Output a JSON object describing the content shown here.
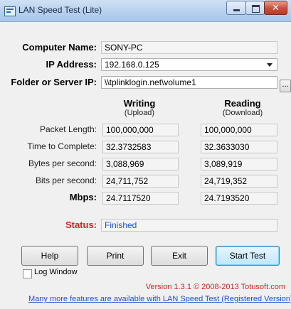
{
  "window": {
    "title": "LAN Speed Test (Lite)"
  },
  "form": {
    "computer_name_label": "Computer Name:",
    "computer_name_value": "SONY-PC",
    "ip_address_label": "IP Address:",
    "ip_address_value": "192.168.0.125",
    "folder_label": "Folder or Server IP:",
    "folder_value": "\\\\tplinklogin.net\\volume1",
    "browse_label": "..."
  },
  "columns": {
    "writing": {
      "title": "Writing",
      "sub": "(Upload)"
    },
    "reading": {
      "title": "Reading",
      "sub": "(Download)"
    }
  },
  "rows": [
    {
      "label": "Packet Length:",
      "writing": "100,000,000",
      "reading": "100,000,000"
    },
    {
      "label": "Time to Complete:",
      "writing": "32.3732583",
      "reading": "32.3633030"
    },
    {
      "label": "Bytes per second:",
      "writing": "3,088,969",
      "reading": "3,089,919"
    },
    {
      "label": "Bits per second:",
      "writing": "24,711,752",
      "reading": "24,719,352"
    },
    {
      "label": "Mbps:",
      "writing": "24.7117520",
      "reading": "24.7193520"
    }
  ],
  "status": {
    "label": "Status:",
    "value": "Finished"
  },
  "buttons": {
    "help": "Help",
    "print": "Print",
    "exit": "Exit",
    "start": "Start Test"
  },
  "log_window": {
    "label": "Log Window",
    "checked": false
  },
  "footer": {
    "version": "Version 1.3.1 © 2008-2013 Totusoft.com",
    "promo": "Many more features are available with LAN Speed Test (Registered Version)"
  }
}
